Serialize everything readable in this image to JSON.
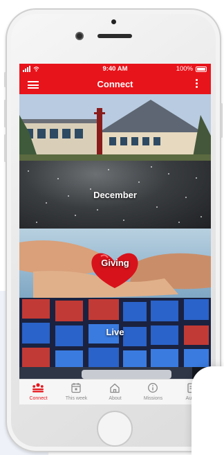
{
  "status_bar": {
    "time": "9:40 AM",
    "battery": "100%"
  },
  "app_bar": {
    "title": "Connect"
  },
  "tiles": [
    {
      "label": ""
    },
    {
      "label": "December"
    },
    {
      "label": "Giving"
    },
    {
      "label": "Live"
    },
    {
      "label": ""
    }
  ],
  "tab_bar": {
    "items": [
      {
        "label": "Connect",
        "icon": "people-icon",
        "active": true
      },
      {
        "label": "This week",
        "icon": "calendar-icon",
        "active": false
      },
      {
        "label": "About",
        "icon": "home-icon",
        "active": false
      },
      {
        "label": "Missions",
        "icon": "info-icon",
        "active": false
      },
      {
        "label": "Audio",
        "icon": "document-icon",
        "active": false
      }
    ]
  },
  "colors": {
    "accent": "#e8141b",
    "tab_inactive": "#8a8a8a",
    "tab_bg": "#f6f6f6"
  }
}
